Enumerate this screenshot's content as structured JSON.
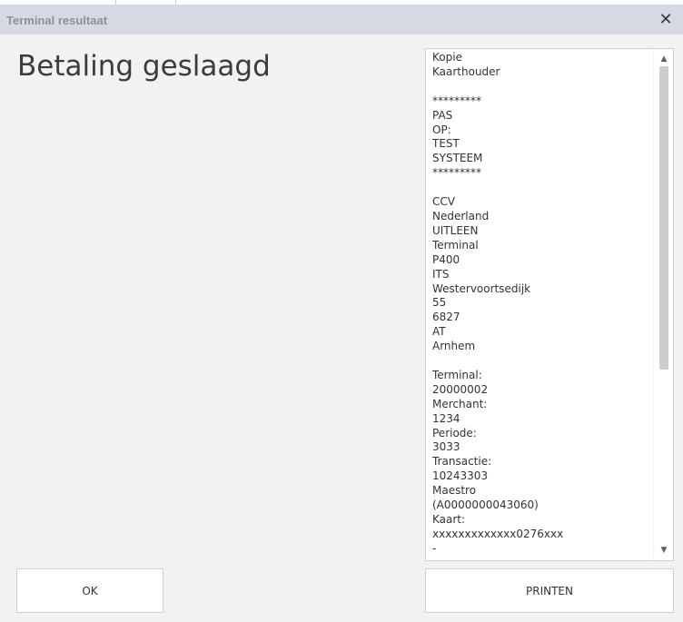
{
  "window": {
    "title": "Terminal resultaat",
    "close_glyph": "✕",
    "close_icon": "close-icon"
  },
  "main": {
    "status_message": "Betaling geslaagd"
  },
  "receipt": {
    "lines": [
      "Kopie",
      "Kaarthouder",
      "",
      "*********",
      "PAS",
      "OP:",
      "TEST",
      "SYSTEEM",
      "*********",
      "",
      "CCV",
      "Nederland",
      "UITLEEN",
      "Terminal",
      "P400",
      "ITS",
      "Westervoortsedijk",
      "55",
      "6827",
      "AT",
      "Arnhem",
      "",
      "Terminal:",
      "20000002",
      "Merchant:",
      "1234",
      "Periode:",
      "3033",
      "Transactie:",
      "10243303",
      "Maestro",
      "(A0000000043060)",
      "Kaart:",
      "xxxxxxxxxxxxx0276xxx",
      "-"
    ],
    "scroll_up_glyph": "▲",
    "scroll_down_glyph": "▼"
  },
  "buttons": {
    "ok_label": "OK",
    "print_label": "PRINTEN"
  },
  "colors": {
    "titlebar_bg": "#d5d9e4",
    "title_text": "#8b9099",
    "page_bg": "#f2f2f2",
    "scroll_thumb": "#cdcdcd"
  }
}
